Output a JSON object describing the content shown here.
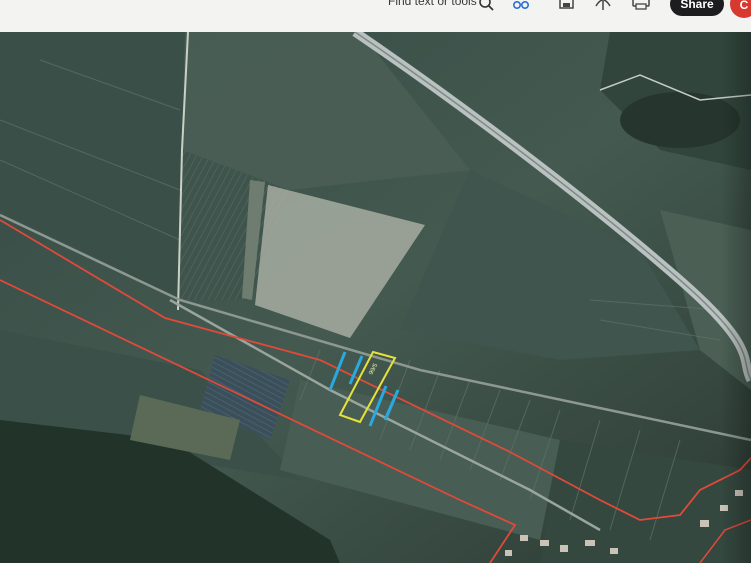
{
  "toolbar": {
    "find_placeholder": "Find text or tools",
    "share_label": "Share",
    "avatar_initial": "C",
    "icons": [
      "search-icon",
      "link-icon",
      "save-icon",
      "upload-icon",
      "print-icon"
    ]
  },
  "map": {
    "parcel_label": "99/5",
    "colors": {
      "boundary": "#e04a3a",
      "parcel": "#e6e23a",
      "marker": "#2aa9e0",
      "highway": "#b9c2c0"
    }
  }
}
